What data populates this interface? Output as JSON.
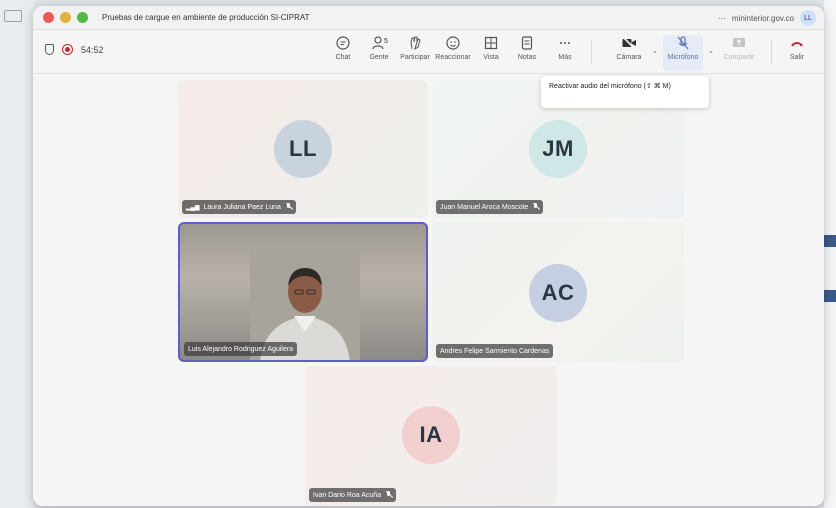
{
  "window": {
    "title": "Pruebas de cargue en ambiente de producción SI-CIPRAT",
    "domain": "mininterior.gov.co",
    "user_initials": "LL",
    "more": "···"
  },
  "toolbar": {
    "timer": "54:52",
    "chat": "Chat",
    "people": "Gente",
    "people_count": "5",
    "raise": "Participar",
    "react": "Reaccionar",
    "view": "Vista",
    "notes": "Notas",
    "more": "Más",
    "camera": "Cámara",
    "mic": "Micrófono",
    "share": "Compartir",
    "leave": "Salir"
  },
  "tooltip": {
    "text": "Reactivar audio del micrófono (⇧ ⌘ M)"
  },
  "participants": [
    {
      "initials": "LL",
      "name": "Laura Juliana Paez Luna",
      "avatar_color": "#c9d3dd"
    },
    {
      "initials": "JM",
      "name": "Juan Manuel Aroca Moscote",
      "avatar_color": "#cfe7e6"
    },
    {
      "initials": "",
      "name": "Luis Alejandro Rodriguez Aguilera"
    },
    {
      "initials": "AC",
      "name": "Andres Felipe Sarmiento Cardenas",
      "avatar_color": "#c6cfe2"
    },
    {
      "initials": "IA",
      "name": "Ivan Dario Roa Acuña",
      "avatar_color": "#f2cfcf"
    }
  ],
  "colors": {
    "accent": "#5b5fc7",
    "record": "#c4262e",
    "leave": "#c4262e"
  }
}
